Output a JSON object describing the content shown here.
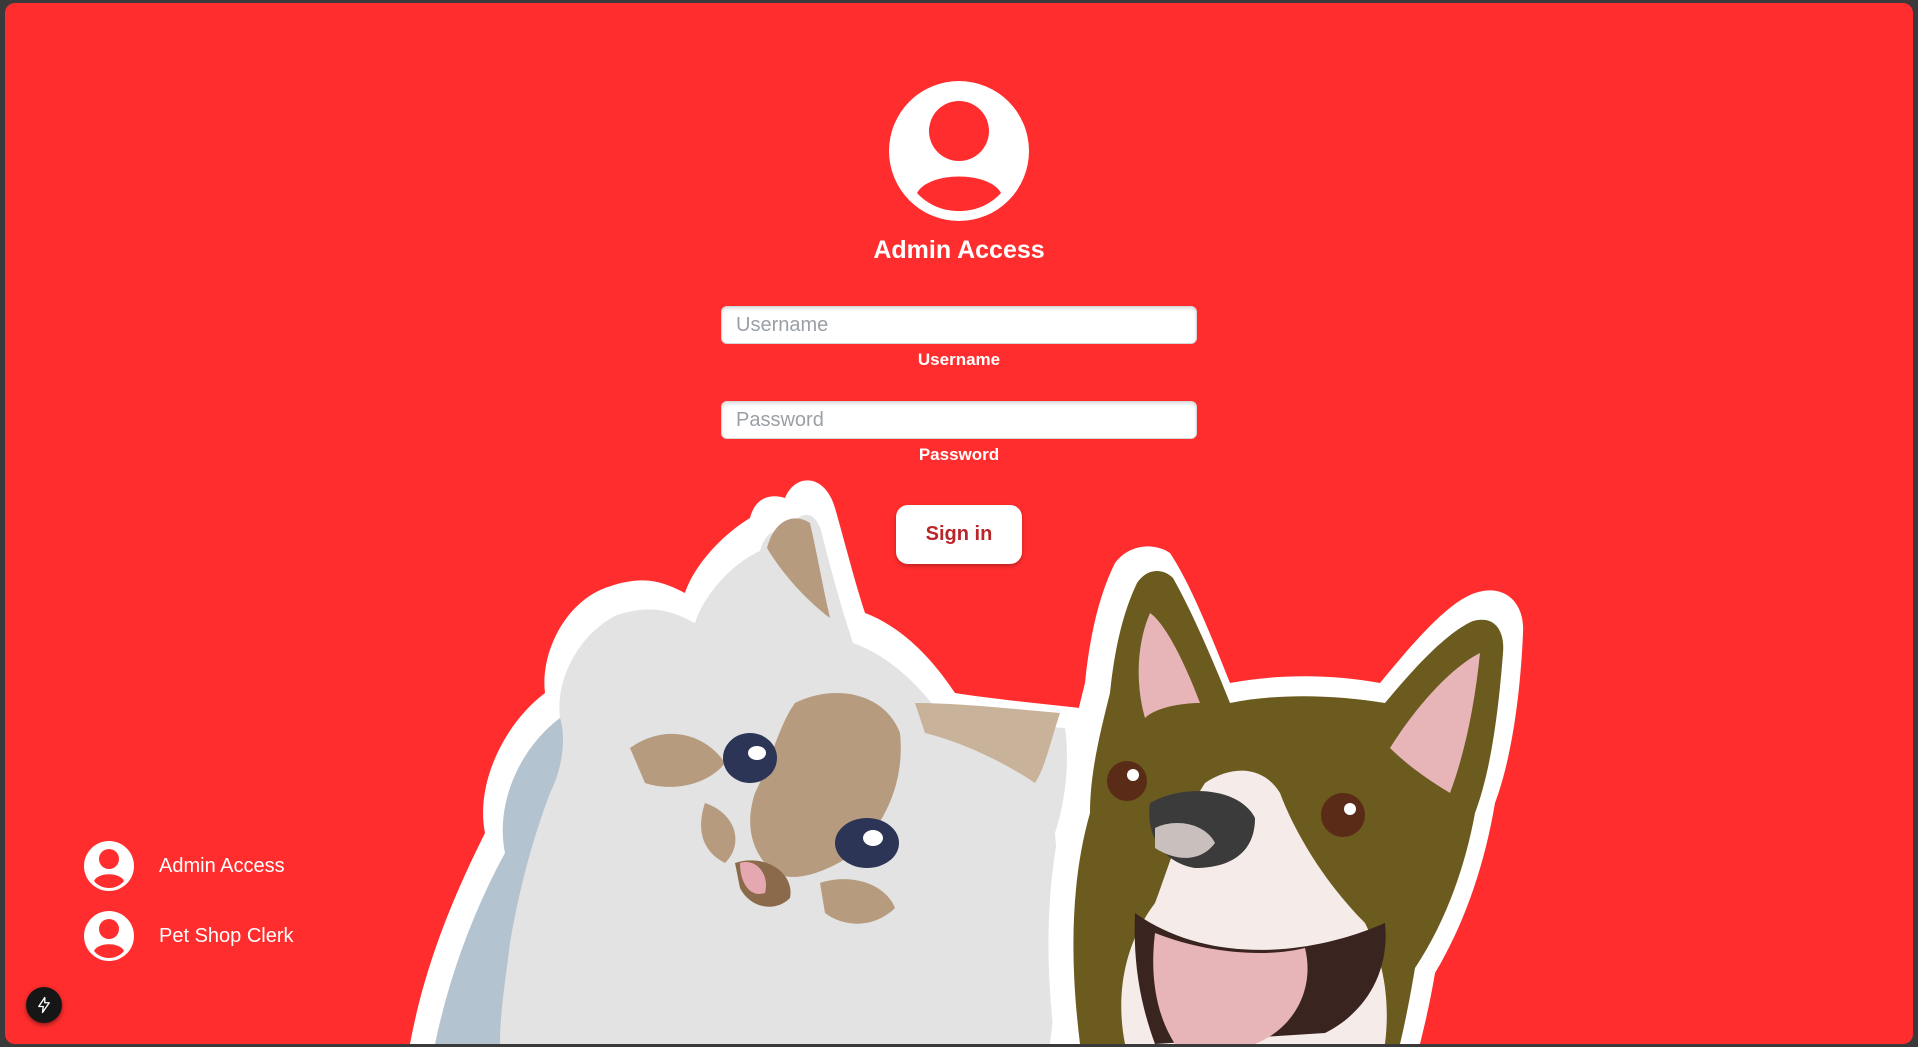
{
  "login": {
    "title": "Admin Access",
    "username": {
      "placeholder": "Username",
      "label": "Username"
    },
    "password": {
      "placeholder": "Password",
      "label": "Password"
    },
    "signin_label": "Sign in"
  },
  "roles": [
    {
      "label": "Admin Access",
      "icon": "user-avatar-icon"
    },
    {
      "label": "Pet Shop Clerk",
      "icon": "user-avatar-icon"
    }
  ],
  "colors": {
    "background": "#ff2d2d",
    "text": "#ffffff",
    "button_text": "#b8262a",
    "dog_fur": "#6b5b1e",
    "cat_fur": "#e3e3e3"
  },
  "icons": {
    "avatar": "user-avatar-icon",
    "dev_tools": "lightning-bolt-icon"
  }
}
